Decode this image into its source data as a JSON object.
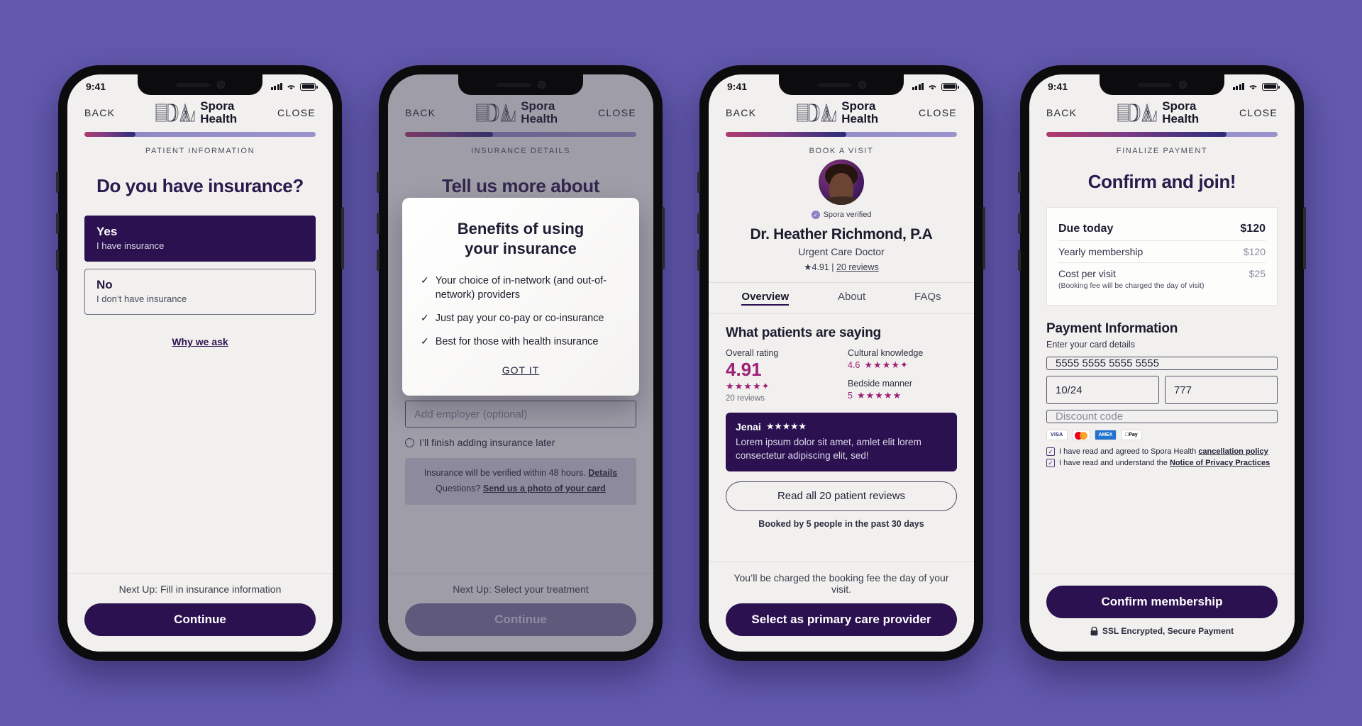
{
  "brand": {
    "name_line1": "Spora",
    "name_line2": "Health"
  },
  "status": {
    "time": "9:41"
  },
  "nav": {
    "back": "BACK",
    "close": "CLOSE"
  },
  "phones": [
    {
      "step_label": "PATIENT INFORMATION",
      "progress_pct": 22,
      "heading": "Do you have insurance?",
      "choices": [
        {
          "title": "Yes",
          "subtitle": "I have insurance",
          "selected": true
        },
        {
          "title": "No",
          "subtitle": "I don’t have insurance",
          "selected": false
        }
      ],
      "why_we_ask": "Why we ask",
      "footer": {
        "next_up": "Next Up: Fill in insurance information",
        "button": "Continue"
      }
    },
    {
      "step_label": "INSURANCE DETAILS",
      "progress_pct": 38,
      "heading": "Tell us more about",
      "modal": {
        "title_line1": "Benefits of using",
        "title_line2": "your insurance",
        "benefits": [
          "Your choice of in-network (and out-of-network) providers",
          "Just pay your co-pay or co-insurance",
          "Best for those with health insurance"
        ],
        "dismiss": "GOT IT"
      },
      "employer_placeholder": "Add employer (optional)",
      "later_option": "I’ll finish adding insurance later",
      "notice_line1_text": "Insurance will be verified within 48 hours. ",
      "notice_line1_link": "Details",
      "notice_line2_text": "Questions? ",
      "notice_line2_link": "Send us a photo of your card",
      "footer": {
        "next_up": "Next Up: Select your treatment",
        "button": "Continue"
      }
    },
    {
      "step_label": "BOOK A VISIT",
      "progress_pct": 52,
      "verified": "Spora verified",
      "doctor_name": "Dr. Heather Richmond, P.A",
      "doctor_role": "Urgent Care Doctor",
      "rating_star": "★",
      "rating_value": "4.91",
      "rating_divider": " | ",
      "rating_reviews_link": "20 reviews",
      "tabs": [
        {
          "label": "Overview",
          "active": true
        },
        {
          "label": "About",
          "active": false
        },
        {
          "label": "FAQs",
          "active": false
        }
      ],
      "section_title": "What patients are saying",
      "overall_label": "Overall rating",
      "overall_value": "4.91",
      "overall_stars": "★★★★✦",
      "overall_reviews": "20 reviews",
      "cultural_label": "Cultural knowledge",
      "cultural_value": "4.6",
      "cultural_stars": "★★★★✦",
      "bedside_label": "Bedside manner",
      "bedside_value": "5",
      "bedside_stars": "★★★★★",
      "review": {
        "author": "Jenai",
        "stars": "★★★★★",
        "text": "Lorem ipsum dolor sit amet, amlet elit lorem consectetur adipiscing elit, sed!"
      },
      "read_all": "Read all 20 patient reviews",
      "booked_note": "Booked by 5 people in the past 30 days",
      "footer": {
        "next_up": "You’ll be charged the booking fee the day of your visit.",
        "button": "Select as primary care provider"
      }
    },
    {
      "step_label": "FINALIZE PAYMENT",
      "progress_pct": 78,
      "heading": "Confirm and join!",
      "summary": [
        {
          "label": "Due today",
          "value": "$120",
          "note": "",
          "emphasis": true
        },
        {
          "label": "Yearly membership",
          "value": "$120",
          "note": "",
          "emphasis": false
        },
        {
          "label": "Cost per visit",
          "value": "$25",
          "note": "(Booking fee will be charged the day of visit)",
          "emphasis": false
        }
      ],
      "payment_title": "Payment Information",
      "payment_sub": "Enter your card details",
      "card_number": "5555 5555 5555 5555",
      "card_expiry": "10/24",
      "card_cvc": "777",
      "discount_placeholder": "Discount code",
      "card_brands": [
        "VISA",
        "mastercard",
        "AMEX",
        "Pay"
      ],
      "consents": [
        {
          "text": "I have read and agreed to Spora Health ",
          "link": "cancellation policy",
          "checked": true
        },
        {
          "text": "I have read and understand the ",
          "link": "Notice of Privacy Practices",
          "checked": true
        }
      ],
      "footer": {
        "button": "Confirm membership",
        "ssl": "SSL Encrypted, Secure Payment"
      }
    }
  ],
  "colors": {
    "background": "#6259ae",
    "primary": "#2b1150",
    "accent_magenta": "#9c1f76",
    "screen_bg": "#f1f0ee"
  }
}
